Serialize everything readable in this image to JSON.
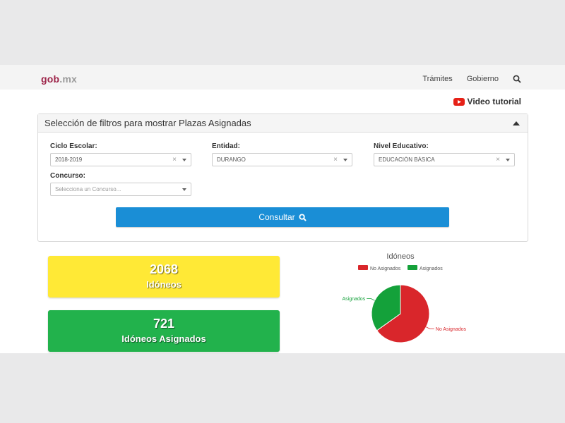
{
  "header": {
    "logo_gob": "gob",
    "logo_mx": ".mx",
    "nav": [
      "Trámites",
      "Gobierno"
    ]
  },
  "video_tutorial": "Video tutorial",
  "filters": {
    "title": "Selección de filtros para mostrar Plazas Asignadas",
    "ciclo_label": "Ciclo Escolar:",
    "ciclo_value": "2018-2019",
    "entidad_label": "Entidad:",
    "entidad_value": "DURANGO",
    "nivel_label": "Nivel Educativo:",
    "nivel_value": "EDUCACIÓN BÁSICA",
    "concurso_label": "Concurso:",
    "concurso_placeholder": "Selecciona un Concurso...",
    "consultar_label": "Consultar"
  },
  "cards": {
    "idoneos_count": "2068",
    "idoneos_label": "Idóneos",
    "asignados_count": "721",
    "asignados_label": "Idóneos Asignados"
  },
  "colors": {
    "yellow": "#ffe936",
    "green": "#22b24c",
    "red": "#d9262b",
    "green_chart": "#14a13a",
    "brand": "#9d2449",
    "button": "#1a8ed6"
  },
  "chart_data": {
    "type": "pie",
    "title": "Idóneos",
    "legend": [
      "No Asignados",
      "Asignados"
    ],
    "legend_position": "top",
    "series": [
      {
        "name": "No Asignados",
        "value": 1347,
        "color": "#d9262b"
      },
      {
        "name": "Asignados",
        "value": 721,
        "color": "#14a13a"
      }
    ]
  }
}
